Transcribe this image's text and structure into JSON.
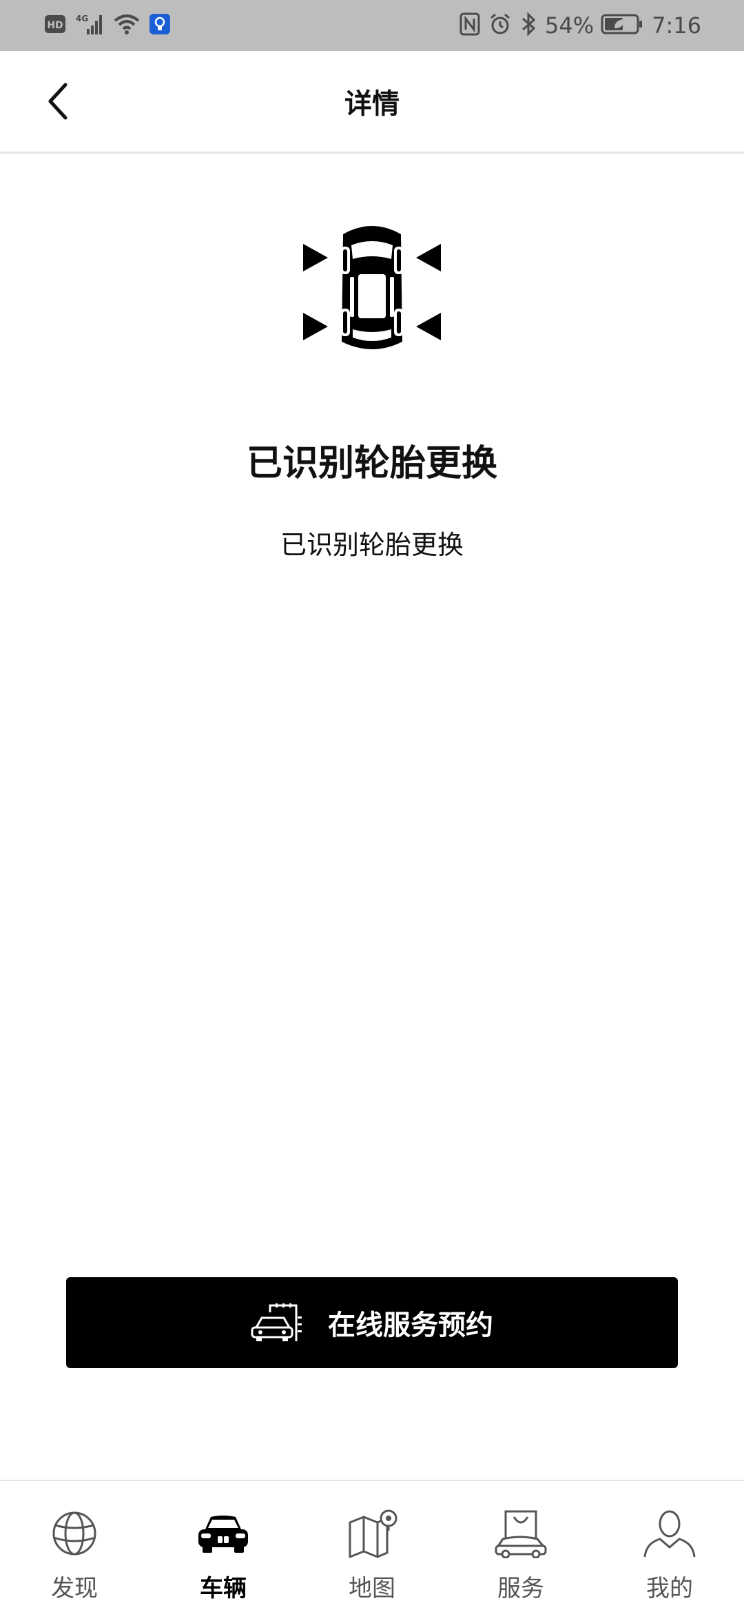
{
  "status_bar": {
    "left_icons": [
      "hd-icon",
      "4g-signal-icon",
      "wifi-icon",
      "lightbulb-app-icon"
    ],
    "network_label": "HD",
    "mobile_label": "4G",
    "battery_percent": "54%",
    "time": "7:16",
    "right_icons": [
      "nfc-icon",
      "alarm-icon",
      "bluetooth-icon",
      "battery-icon"
    ]
  },
  "header": {
    "back_icon": "chevron-left-icon",
    "title": "详情"
  },
  "content": {
    "icon": "car-tires-icon",
    "title": "已识别轮胎更换",
    "subtitle": "已识别轮胎更换"
  },
  "service_button": {
    "icon": "car-service-icon",
    "label": "在线服务预约"
  },
  "bottom_nav": {
    "items": [
      {
        "label": "发现",
        "icon": "globe-icon",
        "active": false
      },
      {
        "label": "车辆",
        "icon": "car-icon",
        "active": true
      },
      {
        "label": "地图",
        "icon": "map-icon",
        "active": false
      },
      {
        "label": "服务",
        "icon": "shopping-car-icon",
        "active": false
      },
      {
        "label": "我的",
        "icon": "user-icon",
        "active": false
      }
    ]
  },
  "colors": {
    "status_bar_bg": "#bdbdbd",
    "accent": "#000000",
    "app_icon_blue": "#1a5fd6"
  }
}
